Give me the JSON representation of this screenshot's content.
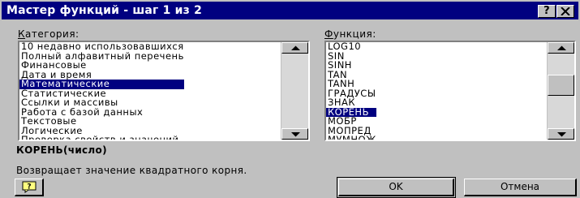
{
  "dialog": {
    "title": "Мастер функций - шаг 1 из 2",
    "help_btn": "?",
    "close_btn": "✕"
  },
  "category": {
    "label_first": "К",
    "label_rest": "атегория:",
    "items": [
      "10 недавно использовавшихся",
      "Полный алфавитный перечень",
      "Финансовые",
      "Дата и время",
      "Математические",
      "Статистические",
      "Ссылки и массивы",
      "Работа с базой данных",
      "Текстовые",
      "Логические",
      "Проверка свойств и значений"
    ],
    "selected_index": 4
  },
  "function": {
    "label_first": "Ф",
    "label_rest": "ункция:",
    "items": [
      "LOG10",
      "SIN",
      "SINH",
      "TAN",
      "TANH",
      "ГРАДУСЫ",
      "ЗНАК",
      "КОРЕНЬ",
      "МОБР",
      "МОПРЕД",
      "МУМНОЖ"
    ],
    "selected_index": 7
  },
  "signature": "КОРЕНЬ(число)",
  "description": "Возвращает значение квадратного корня.",
  "buttons": {
    "ok": "OK",
    "cancel": "Отмена"
  }
}
